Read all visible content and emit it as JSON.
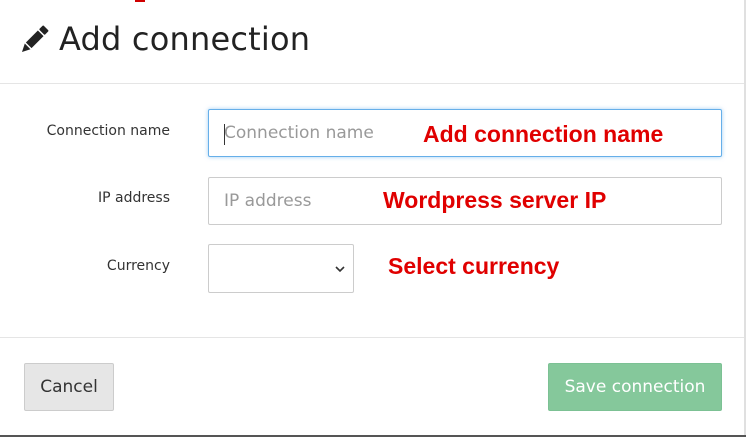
{
  "dialog": {
    "title": "Add connection",
    "header_icon": "pencil-icon"
  },
  "form": {
    "connection_name": {
      "label": "Connection name",
      "placeholder": "Connection name",
      "value": "",
      "annotation": "Add connection name"
    },
    "ip_address": {
      "label": "IP address",
      "placeholder": "IP address",
      "value": "",
      "annotation": "Wordpress server IP"
    },
    "currency": {
      "label": "Currency",
      "selected": "",
      "annotation": "Select currency",
      "icon": "chevron-down-icon"
    }
  },
  "footer": {
    "cancel_label": "Cancel",
    "save_label": "Save connection"
  },
  "colors": {
    "annotation": "#e00000",
    "save_button_bg": "#85c89b",
    "focus_border": "#66afe9"
  }
}
